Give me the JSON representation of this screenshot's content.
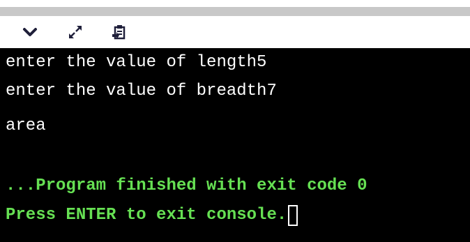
{
  "toolbar": {
    "buttons": [
      {
        "icon": "chevron-down-icon"
      },
      {
        "icon": "expand-icon"
      },
      {
        "icon": "clipboard-icon"
      }
    ]
  },
  "console": {
    "lines": [
      "enter the value of length5",
      "enter the value of breadth7",
      "area",
      "",
      "...Program finished with exit code 0",
      "Press ENTER to exit console."
    ],
    "colors": {
      "background": "#000000",
      "output_text": "#ffffff",
      "status_text": "#66e053",
      "toolbar_strip": "#c8c8c8"
    }
  }
}
